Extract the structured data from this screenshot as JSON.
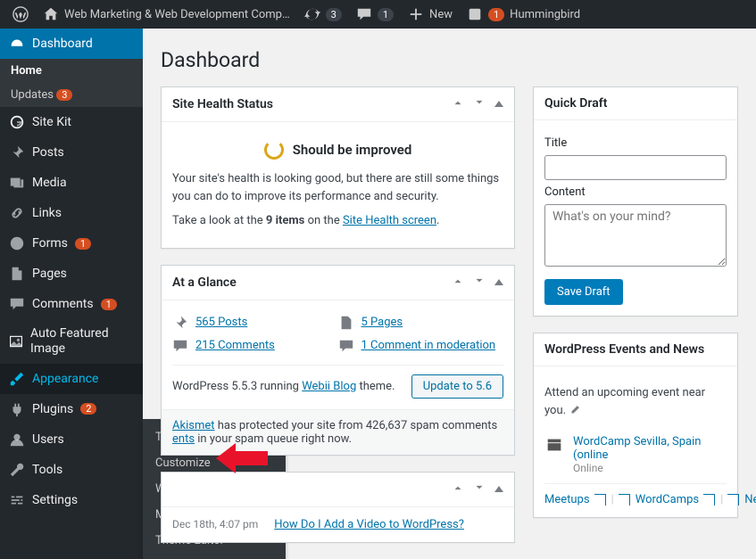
{
  "adminbar": {
    "site_title": "Web Marketing & Web Development Comp…",
    "updates": "3",
    "comments": "1",
    "new_label": "New",
    "hummingbird": "Hummingbird",
    "hb_count": "1"
  },
  "sidebar": {
    "dashboard": "Dashboard",
    "dash_home": "Home",
    "dash_updates": "Updates",
    "dash_updates_count": "3",
    "sitekit": "Site Kit",
    "posts": "Posts",
    "media": "Media",
    "links": "Links",
    "forms": "Forms",
    "forms_count": "1",
    "pages": "Pages",
    "comments": "Comments",
    "comments_count": "1",
    "autofeat": "Auto Featured Image",
    "appearance": "Appearance",
    "plugins": "Plugins",
    "plugins_count": "2",
    "users": "Users",
    "tools": "Tools",
    "settings": "Settings"
  },
  "flyout": {
    "themes": "Themes",
    "customize": "Customize",
    "widgets": "Widgets",
    "menus": "Menus",
    "theme_editor": "Theme Editor"
  },
  "page": {
    "title": "Dashboard"
  },
  "health": {
    "title": "Site Health Status",
    "status": "Should be improved",
    "desc": "Your site's health is looking good, but there are still some things you can do to improve its performance and security.",
    "take_look_pre": "Take a look at the ",
    "take_look_bold": "9 items",
    "take_look_mid": " on the ",
    "take_look_link": "Site Health screen",
    "take_look_post": "."
  },
  "glance": {
    "title": "At a Glance",
    "posts": "565 Posts",
    "pages": "5 Pages",
    "comments": "215 Comments",
    "moderation": "1 Comment in moderation",
    "version_pre": "WordPress 5.5.3 running ",
    "version_link": "Webii Blog",
    "version_post": " theme.",
    "update_btn": "Update to 5.6",
    "akismet_link": "Akismet",
    "akismet_txt": " has protected your site from 426,637 spam comments",
    "akismet_queue_link": "ents",
    "akismet_queue_post": " in your spam queue right now."
  },
  "activity": {
    "date": "Dec 18th, 4:07 pm",
    "post": "How Do I Add a Video to WordPress?"
  },
  "quickdraft": {
    "title": "Quick Draft",
    "title_label": "Title",
    "content_label": "Content",
    "content_ph": "What's on your mind?",
    "save": "Save Draft"
  },
  "events": {
    "title": "WordPress Events and News",
    "attend": "Attend an upcoming event near you.",
    "ev1_title": "WordCamp Sevilla, Spain (online",
    "ev1_sub": "Online",
    "meetups": "Meetups",
    "wordcamps": "WordCamps",
    "news": "News"
  }
}
